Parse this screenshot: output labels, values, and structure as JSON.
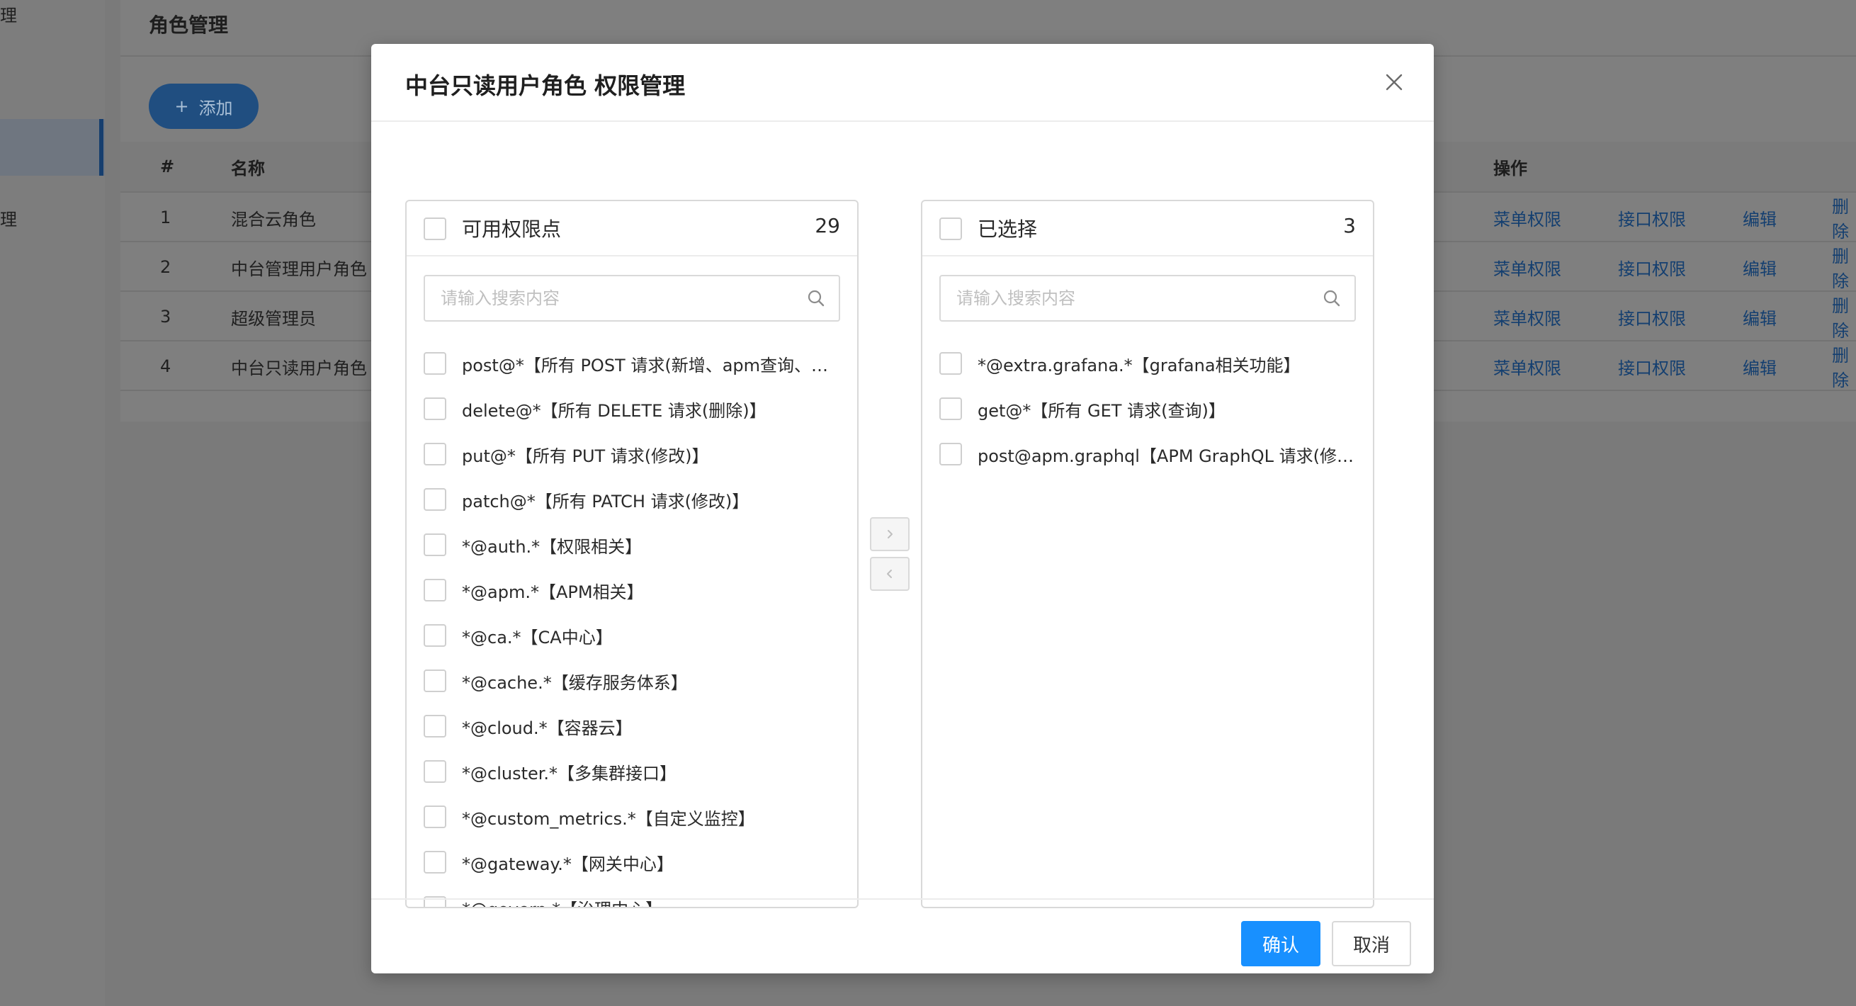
{
  "background": {
    "sidebar": {
      "item_top": "理",
      "item_bottom": "理"
    },
    "page_title": "角色管理",
    "add_button": "添加",
    "table": {
      "headers": {
        "num": "#",
        "name": "名称",
        "ops": "操作"
      },
      "rows": [
        {
          "num": "1",
          "name": "混合云角色"
        },
        {
          "num": "2",
          "name": "中台管理用户角色"
        },
        {
          "num": "3",
          "name": "超级管理员"
        },
        {
          "num": "4",
          "name": "中台只读用户角色"
        }
      ],
      "actions": {
        "menu": "菜单权限",
        "api": "接口权限",
        "edit": "编辑",
        "delete": "删除"
      }
    }
  },
  "modal": {
    "title": "中台只读用户角色 权限管理",
    "left_panel": {
      "title": "可用权限点",
      "count": "29",
      "search_placeholder": "请输入搜索内容",
      "items": [
        "post@*【所有 POST 请求(新增、apm查询、部署操作)】",
        "delete@*【所有 DELETE 请求(删除)】",
        "put@*【所有 PUT 请求(修改)】",
        "patch@*【所有 PATCH 请求(修改)】",
        "*@auth.*【权限相关】",
        "*@apm.*【APM相关】",
        "*@ca.*【CA中心】",
        "*@cache.*【缓存服务体系】",
        "*@cloud.*【容器云】",
        "*@cluster.*【多集群接口】",
        "*@custom_metrics.*【自定义监控】",
        "*@gateway.*【网关中心】",
        "*@govern.*【治理中心】"
      ]
    },
    "right_panel": {
      "title": "已选择",
      "count": "3",
      "search_placeholder": "请输入搜索内容",
      "items": [
        "*@extra.grafana.*【grafana相关功能】",
        "get@*【所有 GET 请求(查询)】",
        "post@apm.graphql【APM GraphQL 请求(修改数据)】"
      ]
    },
    "confirm_label": "确认",
    "cancel_label": "取消"
  },
  "colors": {
    "primary": "#1890ff",
    "overlay": "#7a7a7a",
    "link_dimmed": "#143f70"
  }
}
